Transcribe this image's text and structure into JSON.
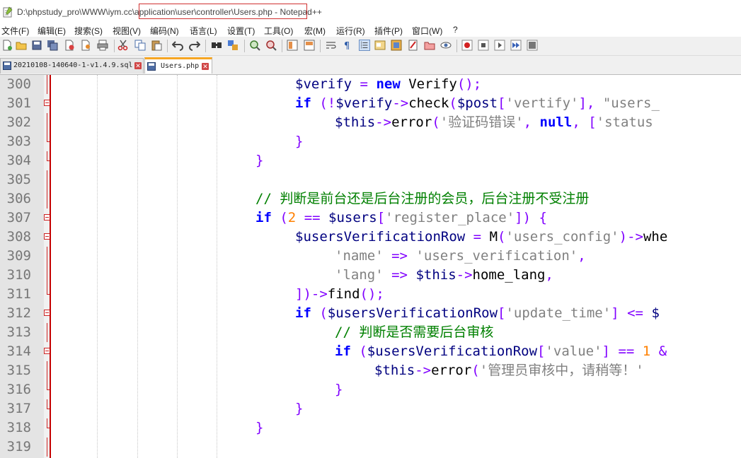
{
  "window": {
    "title_prefix": "D:\\phpstudy_pro\\WWW\\iym.c",
    "title_highlight": "c\\application\\user\\controller\\Users.php",
    "title_suffix": " - Notepad++"
  },
  "menu": [
    "文件(F)",
    "编辑(E)",
    "搜索(S)",
    "视图(V)",
    "编码(N)",
    "语言(L)",
    "设置(T)",
    "工具(O)",
    "宏(M)",
    "运行(R)",
    "插件(P)",
    "窗口(W)",
    "?"
  ],
  "tabs": [
    {
      "label": "20210108-140640-1-v1.4.9.sql",
      "active": false
    },
    {
      "label": "Users.php",
      "active": true
    }
  ],
  "colors": {
    "keyword": "#0000ff",
    "variable": "#000080",
    "string": "#808080",
    "number": "#ff8000",
    "comment": "#008000",
    "operator": "#8000ff",
    "fold_marker": "#cc2222",
    "edge_line": "#c40000"
  },
  "editor": {
    "lines": [
      {
        "num": "300",
        "fold": "vert",
        "indent": 6,
        "tokens": [
          [
            "var",
            "$verify"
          ],
          [
            "plain",
            " "
          ],
          [
            "op",
            "="
          ],
          [
            "plain",
            " "
          ],
          [
            "kw",
            "new"
          ],
          [
            "plain",
            " Verify"
          ],
          [
            "op",
            "();"
          ]
        ]
      },
      {
        "num": "301",
        "fold": "box",
        "indent": 6,
        "tokens": [
          [
            "kw",
            "if"
          ],
          [
            "plain",
            " "
          ],
          [
            "op",
            "(!"
          ],
          [
            "var",
            "$verify"
          ],
          [
            "op",
            "->"
          ],
          [
            "plain",
            "check"
          ],
          [
            "op",
            "("
          ],
          [
            "var",
            "$post"
          ],
          [
            "op",
            "["
          ],
          [
            "str",
            "'vertify'"
          ],
          [
            "op",
            "],"
          ],
          [
            "plain",
            " "
          ],
          [
            "str",
            "\"users_"
          ]
        ]
      },
      {
        "num": "302",
        "fold": "vert",
        "indent": 7,
        "tokens": [
          [
            "var",
            "$this"
          ],
          [
            "op",
            "->"
          ],
          [
            "plain",
            "error"
          ],
          [
            "op",
            "("
          ],
          [
            "str",
            "'验证码错误'"
          ],
          [
            "op",
            ","
          ],
          [
            "plain",
            " "
          ],
          [
            "kw",
            "null"
          ],
          [
            "op",
            ","
          ],
          [
            "plain",
            " "
          ],
          [
            "op",
            "["
          ],
          [
            "str",
            "'status"
          ]
        ]
      },
      {
        "num": "303",
        "fold": "end",
        "indent": 6,
        "tokens": [
          [
            "op",
            "}"
          ]
        ]
      },
      {
        "num": "304",
        "fold": "end",
        "indent": 5,
        "tokens": [
          [
            "op",
            "}"
          ]
        ]
      },
      {
        "num": "305",
        "fold": "vert",
        "indent": 0,
        "tokens": []
      },
      {
        "num": "306",
        "fold": "vert",
        "indent": 5,
        "tokens": [
          [
            "cmt",
            "// 判断是前台还是后台注册的会员，后台注册不受注册"
          ]
        ]
      },
      {
        "num": "307",
        "fold": "box",
        "indent": 5,
        "tokens": [
          [
            "kw",
            "if"
          ],
          [
            "plain",
            " "
          ],
          [
            "op",
            "("
          ],
          [
            "num",
            "2"
          ],
          [
            "plain",
            " "
          ],
          [
            "op",
            "=="
          ],
          [
            "plain",
            " "
          ],
          [
            "var",
            "$users"
          ],
          [
            "op",
            "["
          ],
          [
            "str",
            "'register_place'"
          ],
          [
            "op",
            "])"
          ],
          [
            "plain",
            " "
          ],
          [
            "op",
            "{"
          ]
        ]
      },
      {
        "num": "308",
        "fold": "box",
        "indent": 6,
        "tokens": [
          [
            "var",
            "$usersVerificationRow"
          ],
          [
            "plain",
            " "
          ],
          [
            "op",
            "="
          ],
          [
            "plain",
            " M"
          ],
          [
            "op",
            "("
          ],
          [
            "str",
            "'users_config'"
          ],
          [
            "op",
            ")->"
          ],
          [
            "plain",
            "whe"
          ]
        ]
      },
      {
        "num": "309",
        "fold": "vert",
        "indent": 7,
        "tokens": [
          [
            "str",
            "'name'"
          ],
          [
            "plain",
            " "
          ],
          [
            "op",
            "=>"
          ],
          [
            "plain",
            " "
          ],
          [
            "str",
            "'users_verification'"
          ],
          [
            "op",
            ","
          ]
        ]
      },
      {
        "num": "310",
        "fold": "vert",
        "indent": 7,
        "tokens": [
          [
            "str",
            "'lang'"
          ],
          [
            "plain",
            " "
          ],
          [
            "op",
            "=>"
          ],
          [
            "plain",
            " "
          ],
          [
            "var",
            "$this"
          ],
          [
            "op",
            "->"
          ],
          [
            "plain",
            "home_lang"
          ],
          [
            "op",
            ","
          ]
        ]
      },
      {
        "num": "311",
        "fold": "end",
        "indent": 6,
        "tokens": [
          [
            "op",
            "])->"
          ],
          [
            "plain",
            "find"
          ],
          [
            "op",
            "();"
          ]
        ]
      },
      {
        "num": "312",
        "fold": "box",
        "indent": 6,
        "tokens": [
          [
            "kw",
            "if"
          ],
          [
            "plain",
            " "
          ],
          [
            "op",
            "("
          ],
          [
            "var",
            "$usersVerificationRow"
          ],
          [
            "op",
            "["
          ],
          [
            "str",
            "'update_time'"
          ],
          [
            "op",
            "]"
          ],
          [
            "plain",
            " "
          ],
          [
            "op",
            "<="
          ],
          [
            "plain",
            " "
          ],
          [
            "var",
            "$"
          ]
        ]
      },
      {
        "num": "313",
        "fold": "vert",
        "indent": 7,
        "tokens": [
          [
            "cmt",
            "// 判断是否需要后台审核"
          ]
        ]
      },
      {
        "num": "314",
        "fold": "box",
        "indent": 7,
        "tokens": [
          [
            "kw",
            "if"
          ],
          [
            "plain",
            " "
          ],
          [
            "op",
            "("
          ],
          [
            "var",
            "$usersVerificationRow"
          ],
          [
            "op",
            "["
          ],
          [
            "str",
            "'value'"
          ],
          [
            "op",
            "]"
          ],
          [
            "plain",
            " "
          ],
          [
            "op",
            "=="
          ],
          [
            "plain",
            " "
          ],
          [
            "num",
            "1"
          ],
          [
            "plain",
            " "
          ],
          [
            "op",
            "&"
          ]
        ]
      },
      {
        "num": "315",
        "fold": "vert",
        "indent": 8,
        "tokens": [
          [
            "var",
            "$this"
          ],
          [
            "op",
            "->"
          ],
          [
            "plain",
            "error"
          ],
          [
            "op",
            "("
          ],
          [
            "str",
            "'管理员审核中，请稍等！'"
          ]
        ]
      },
      {
        "num": "316",
        "fold": "end",
        "indent": 7,
        "tokens": [
          [
            "op",
            "}"
          ]
        ]
      },
      {
        "num": "317",
        "fold": "end",
        "indent": 6,
        "tokens": [
          [
            "op",
            "}"
          ]
        ]
      },
      {
        "num": "318",
        "fold": "end",
        "indent": 5,
        "tokens": [
          [
            "op",
            "}"
          ]
        ]
      },
      {
        "num": "319",
        "fold": "vert",
        "indent": 0,
        "tokens": []
      }
    ]
  }
}
